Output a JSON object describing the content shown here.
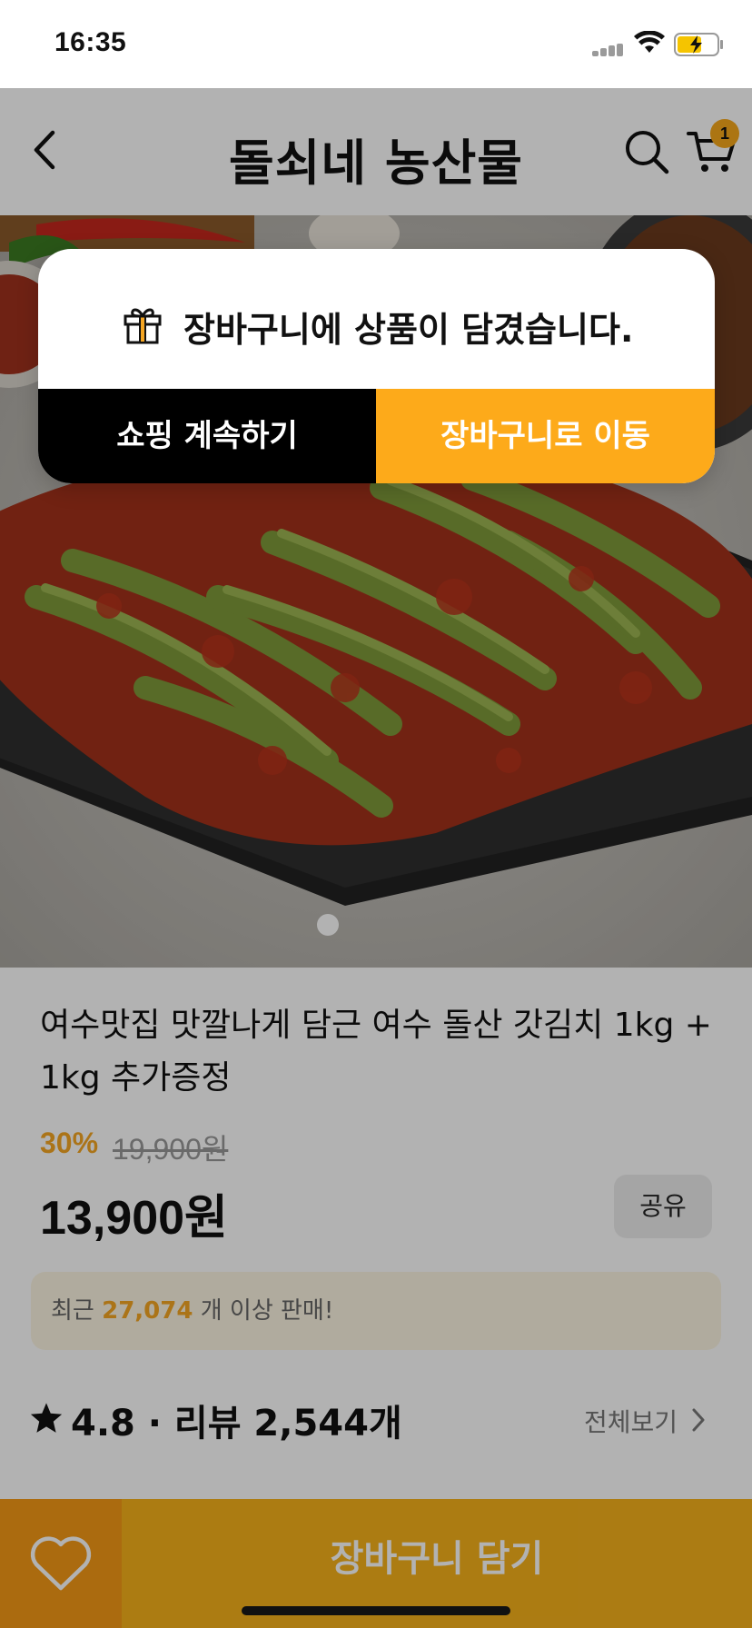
{
  "status_bar": {
    "time": "16:35"
  },
  "header": {
    "title": "돌쇠네 농산물",
    "cart_count": "1"
  },
  "product": {
    "title": "여수맛집 맛깔나게 담근 여수 돌산 갓김치 1kg + 1kg 추가증정",
    "discount": "30%",
    "original_price": "19,900원",
    "price": "13,900원",
    "share_label": "공유",
    "sales_prefix": "최근",
    "sales_count": "27,074",
    "sales_suffix": "개 이상 판매!",
    "rating_text": "4.8 · 리뷰 2,544개",
    "view_all_label": "전체보기"
  },
  "bottom_bar": {
    "add_to_cart_label": "장바구니 담기"
  },
  "dialog": {
    "message": "장바구니에 상품이 담겼습니다.",
    "continue_label": "쇼핑 계속하기",
    "go_cart_label": "장바구니로 이동"
  },
  "colors": {
    "accent": "#f7b21b",
    "discount": "#f5a623",
    "dialog_confirm": "#fdaa1a"
  },
  "icons": [
    "back-icon",
    "search-icon",
    "cart-icon",
    "gift-icon",
    "heart-icon",
    "star-icon",
    "chevron-right-icon"
  ]
}
